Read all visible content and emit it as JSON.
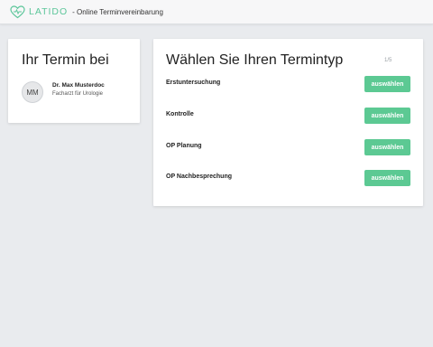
{
  "header": {
    "logo_text": "LATIDO",
    "subtitle": "- Online Terminvereinbarung",
    "logo_icon": "heart-pulse-icon",
    "brand_color": "#5cc69a"
  },
  "doctor_card": {
    "title": "Ihr Termin bei",
    "avatar_initials": "MM",
    "name": "Dr. Max Musterdoc",
    "specialty": "Facharzt für Urologie"
  },
  "appointment_card": {
    "title": "Wählen Sie Ihren Termintyp",
    "step": "1/5",
    "button_color": "#5cc993",
    "types": [
      {
        "label": "Erstuntersuchung",
        "button": "auswählen"
      },
      {
        "label": "Kontrolle",
        "button": "auswählen"
      },
      {
        "label": "OP Planung",
        "button": "auswählen"
      },
      {
        "label": "OP Nachbesprechung",
        "button": "auswählen"
      }
    ]
  }
}
